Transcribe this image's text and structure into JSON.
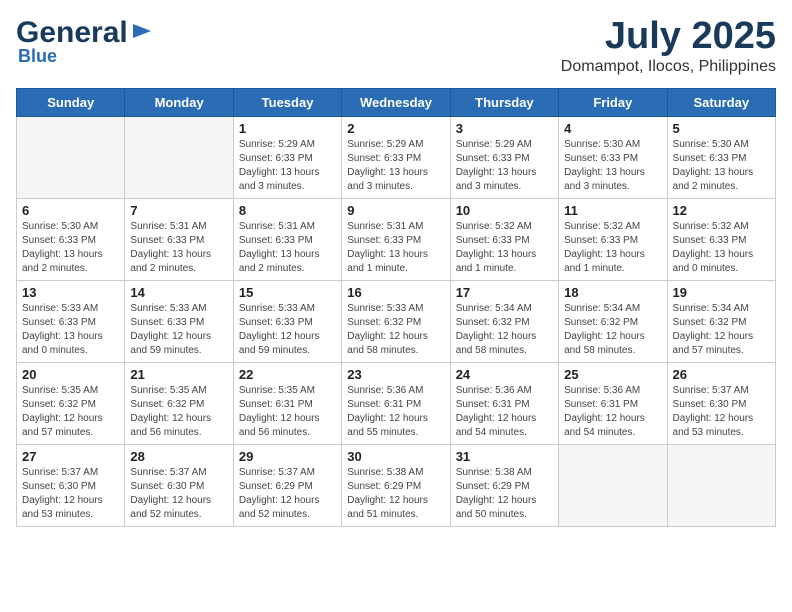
{
  "header": {
    "logo_line1": "General",
    "logo_line2": "Blue",
    "month_year": "July 2025",
    "location": "Domampot, Ilocos, Philippines"
  },
  "weekdays": [
    "Sunday",
    "Monday",
    "Tuesday",
    "Wednesday",
    "Thursday",
    "Friday",
    "Saturday"
  ],
  "weeks": [
    [
      {
        "day": "",
        "info": ""
      },
      {
        "day": "",
        "info": ""
      },
      {
        "day": "1",
        "info": "Sunrise: 5:29 AM\nSunset: 6:33 PM\nDaylight: 13 hours and 3 minutes."
      },
      {
        "day": "2",
        "info": "Sunrise: 5:29 AM\nSunset: 6:33 PM\nDaylight: 13 hours and 3 minutes."
      },
      {
        "day": "3",
        "info": "Sunrise: 5:29 AM\nSunset: 6:33 PM\nDaylight: 13 hours and 3 minutes."
      },
      {
        "day": "4",
        "info": "Sunrise: 5:30 AM\nSunset: 6:33 PM\nDaylight: 13 hours and 3 minutes."
      },
      {
        "day": "5",
        "info": "Sunrise: 5:30 AM\nSunset: 6:33 PM\nDaylight: 13 hours and 2 minutes."
      }
    ],
    [
      {
        "day": "6",
        "info": "Sunrise: 5:30 AM\nSunset: 6:33 PM\nDaylight: 13 hours and 2 minutes."
      },
      {
        "day": "7",
        "info": "Sunrise: 5:31 AM\nSunset: 6:33 PM\nDaylight: 13 hours and 2 minutes."
      },
      {
        "day": "8",
        "info": "Sunrise: 5:31 AM\nSunset: 6:33 PM\nDaylight: 13 hours and 2 minutes."
      },
      {
        "day": "9",
        "info": "Sunrise: 5:31 AM\nSunset: 6:33 PM\nDaylight: 13 hours and 1 minute."
      },
      {
        "day": "10",
        "info": "Sunrise: 5:32 AM\nSunset: 6:33 PM\nDaylight: 13 hours and 1 minute."
      },
      {
        "day": "11",
        "info": "Sunrise: 5:32 AM\nSunset: 6:33 PM\nDaylight: 13 hours and 1 minute."
      },
      {
        "day": "12",
        "info": "Sunrise: 5:32 AM\nSunset: 6:33 PM\nDaylight: 13 hours and 0 minutes."
      }
    ],
    [
      {
        "day": "13",
        "info": "Sunrise: 5:33 AM\nSunset: 6:33 PM\nDaylight: 13 hours and 0 minutes."
      },
      {
        "day": "14",
        "info": "Sunrise: 5:33 AM\nSunset: 6:33 PM\nDaylight: 12 hours and 59 minutes."
      },
      {
        "day": "15",
        "info": "Sunrise: 5:33 AM\nSunset: 6:33 PM\nDaylight: 12 hours and 59 minutes."
      },
      {
        "day": "16",
        "info": "Sunrise: 5:33 AM\nSunset: 6:32 PM\nDaylight: 12 hours and 58 minutes."
      },
      {
        "day": "17",
        "info": "Sunrise: 5:34 AM\nSunset: 6:32 PM\nDaylight: 12 hours and 58 minutes."
      },
      {
        "day": "18",
        "info": "Sunrise: 5:34 AM\nSunset: 6:32 PM\nDaylight: 12 hours and 58 minutes."
      },
      {
        "day": "19",
        "info": "Sunrise: 5:34 AM\nSunset: 6:32 PM\nDaylight: 12 hours and 57 minutes."
      }
    ],
    [
      {
        "day": "20",
        "info": "Sunrise: 5:35 AM\nSunset: 6:32 PM\nDaylight: 12 hours and 57 minutes."
      },
      {
        "day": "21",
        "info": "Sunrise: 5:35 AM\nSunset: 6:32 PM\nDaylight: 12 hours and 56 minutes."
      },
      {
        "day": "22",
        "info": "Sunrise: 5:35 AM\nSunset: 6:31 PM\nDaylight: 12 hours and 56 minutes."
      },
      {
        "day": "23",
        "info": "Sunrise: 5:36 AM\nSunset: 6:31 PM\nDaylight: 12 hours and 55 minutes."
      },
      {
        "day": "24",
        "info": "Sunrise: 5:36 AM\nSunset: 6:31 PM\nDaylight: 12 hours and 54 minutes."
      },
      {
        "day": "25",
        "info": "Sunrise: 5:36 AM\nSunset: 6:31 PM\nDaylight: 12 hours and 54 minutes."
      },
      {
        "day": "26",
        "info": "Sunrise: 5:37 AM\nSunset: 6:30 PM\nDaylight: 12 hours and 53 minutes."
      }
    ],
    [
      {
        "day": "27",
        "info": "Sunrise: 5:37 AM\nSunset: 6:30 PM\nDaylight: 12 hours and 53 minutes."
      },
      {
        "day": "28",
        "info": "Sunrise: 5:37 AM\nSunset: 6:30 PM\nDaylight: 12 hours and 52 minutes."
      },
      {
        "day": "29",
        "info": "Sunrise: 5:37 AM\nSunset: 6:29 PM\nDaylight: 12 hours and 52 minutes."
      },
      {
        "day": "30",
        "info": "Sunrise: 5:38 AM\nSunset: 6:29 PM\nDaylight: 12 hours and 51 minutes."
      },
      {
        "day": "31",
        "info": "Sunrise: 5:38 AM\nSunset: 6:29 PM\nDaylight: 12 hours and 50 minutes."
      },
      {
        "day": "",
        "info": ""
      },
      {
        "day": "",
        "info": ""
      }
    ]
  ]
}
